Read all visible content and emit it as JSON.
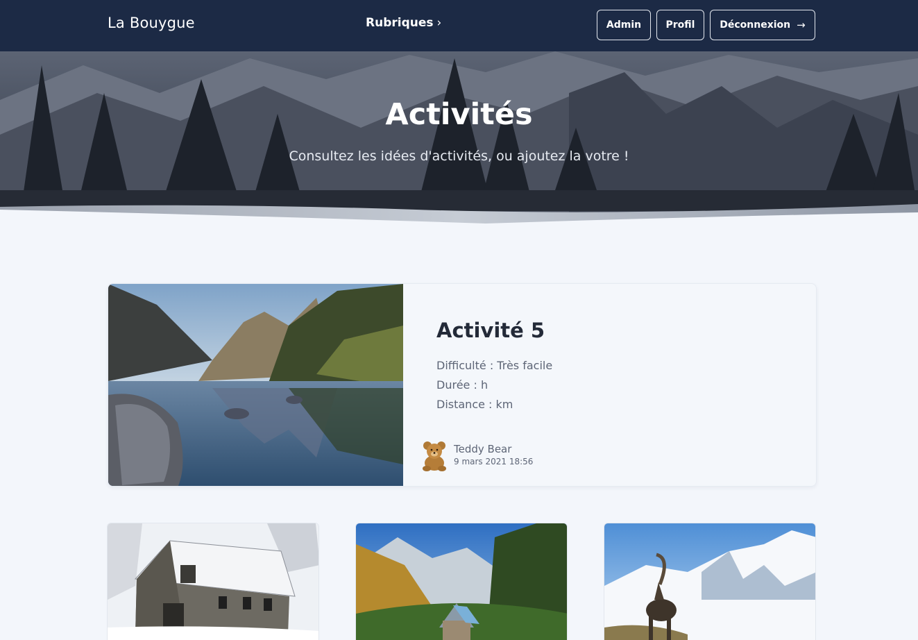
{
  "navbar": {
    "brand": "La Bouygue",
    "rubriques_label": "Rubriques",
    "rubriques_chevron": "›",
    "admin_label": "Admin",
    "profil_label": "Profil",
    "logout_label": "Déconnexion",
    "logout_arrow": "→"
  },
  "hero": {
    "title": "Activités",
    "subtitle": "Consultez les idées d'activités, ou ajoutez la votre !"
  },
  "featured": {
    "title": "Activité 5",
    "difficulty": "Difficulté : Très facile",
    "duration": "Durée : h",
    "distance": "Distance : km",
    "author": "Teddy Bear",
    "date": "9 mars 2021 18:56",
    "avatar_icon": "teddy-bear-icon"
  },
  "cards": [
    {
      "image": "snowy-stone-cabin"
    },
    {
      "image": "mountain-valley-hut"
    },
    {
      "image": "ibex-snowy-peaks"
    }
  ],
  "colors": {
    "navbar": "#1c2a45",
    "page_background": "#f3f6fb",
    "text_dark": "#232a38",
    "text_muted": "#5d6576"
  }
}
